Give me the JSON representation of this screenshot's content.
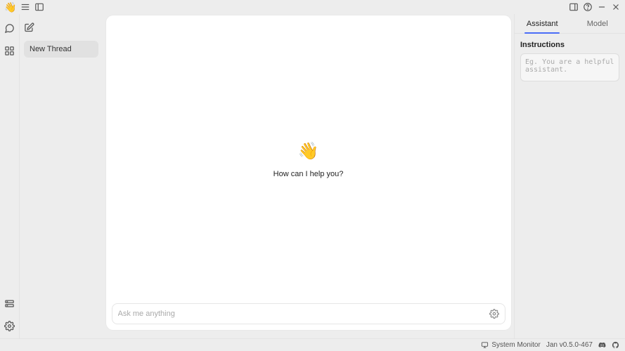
{
  "titlebar": {
    "logo_emoji": "👋"
  },
  "threads": {
    "items": [
      {
        "label": "New Thread"
      }
    ]
  },
  "chat": {
    "wave_emoji": "👋",
    "greeting": "How can I help you?",
    "input_placeholder": "Ask me anything"
  },
  "rightPanel": {
    "tabs": [
      {
        "label": "Assistant",
        "active": true
      },
      {
        "label": "Model",
        "active": false
      }
    ],
    "instructions_title": "Instructions",
    "instructions_placeholder": "Eg. You are a helpful assistant."
  },
  "statusbar": {
    "system_monitor_label": "System Monitor",
    "version": "Jan v0.5.0-467"
  }
}
